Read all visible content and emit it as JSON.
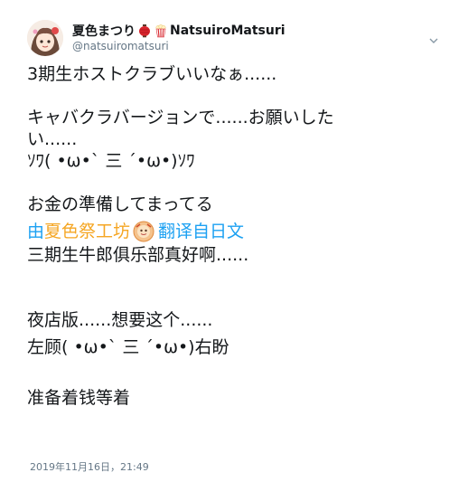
{
  "tweet": {
    "display_name": "夏色まつり",
    "display_name_suffix": "NatsuiroMatsuri",
    "handle": "@natsuiromatsuri",
    "avatar_icon": "avatar-anime-girl",
    "name_emojis": [
      "red-lantern-emoji",
      "popcorn-emoji"
    ],
    "menu_icon": "chevron-down-icon",
    "original_lines": [
      "3期生ホストクラブいいなぁ......",
      "",
      "キャバクラバージョンで......お願いした",
      "い......",
      "ｿﾜ( •ω•` 三 ´•ω•)ｿﾜ",
      "",
      "お金の準備してまってる"
    ],
    "translation": {
      "by_label": "由",
      "source_name": "夏色祭工坊",
      "link_label": "翻译自日文",
      "logo_icon": "translator-logo-icon"
    },
    "translated_lines": [
      "三期生牛郎俱乐部真好啊......",
      "",
      "夜店版......想要这个......",
      "左顾( •ω•` 三 ´•ω•)右盼",
      "",
      "准备着钱等着"
    ],
    "timestamp": "2019年11月16日，21:49"
  },
  "colors": {
    "link_blue": "#1da1f2",
    "source_orange": "#f5a623",
    "secondary_gray": "#657786",
    "text_dark": "#14171a"
  }
}
